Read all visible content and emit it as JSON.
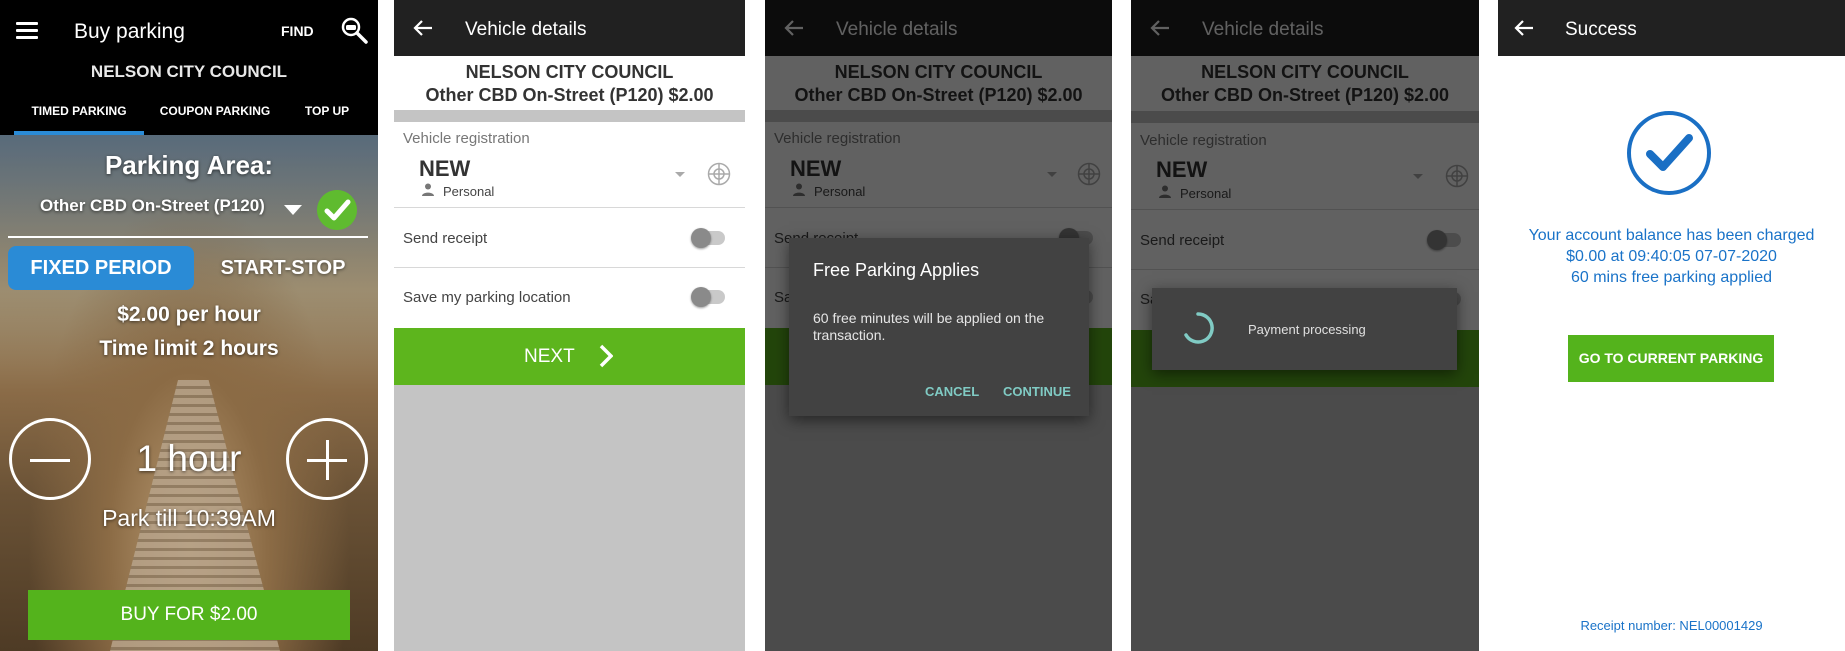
{
  "buy_parking": {
    "title": "Buy parking",
    "find_label": "FIND",
    "council": "NELSON CITY COUNCIL",
    "tabs": [
      "TIMED PARKING",
      "COUPON PARKING",
      "TOP UP"
    ],
    "active_tab": "TIMED PARKING",
    "area_heading": "Parking Area:",
    "area_value": "Other CBD On-Street (P120)",
    "mode_fixed": "FIXED PERIOD",
    "mode_start_stop": "START-STOP",
    "rate": "$2.00 per hour",
    "time_limit": "Time limit 2 hours",
    "duration": "1 hour",
    "park_till": "Park till 10:39AM",
    "buy_button": "BUY FOR $2.00"
  },
  "vehicle_details": {
    "title": "Vehicle details",
    "council": "NELSON CITY COUNCIL",
    "zone_price": "Other CBD On-Street (P120) $2.00",
    "registration_label": "Vehicle registration",
    "registration_value": "NEW",
    "registration_type": "Personal",
    "send_receipt": "Send receipt",
    "save_location": "Save my parking location",
    "next_button": "NEXT"
  },
  "free_parking_dialog": {
    "title": "Free Parking Applies",
    "message": "60 free minutes will be applied on the transaction.",
    "cancel": "CANCEL",
    "continue": "CONTINUE"
  },
  "processing": {
    "message": "Payment processing"
  },
  "success": {
    "title": "Success",
    "message_line1": "Your account balance has been charged",
    "message_line2": "$0.00 at 09:40:05 07-07-2020",
    "message_line3": "60 mins free parking applied",
    "button": "GO TO CURRENT PARKING",
    "receipt": "Receipt number: NEL00001429"
  },
  "colors": {
    "accent_blue": "#2a8bd6",
    "action_green": "#54b31c",
    "success_blue": "#1a73c8",
    "appbar": "#212121"
  }
}
